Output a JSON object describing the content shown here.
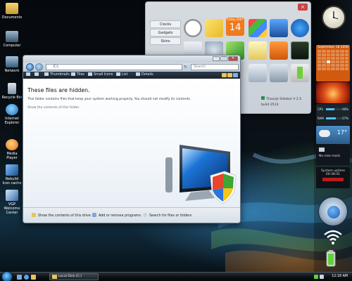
{
  "desktop": {
    "icons": [
      {
        "label": "Documents"
      },
      {
        "label": "Computer"
      },
      {
        "label": "Network"
      },
      {
        "label": "Recycle Bin"
      },
      {
        "label": "Internet Explorer"
      },
      {
        "label": "Media Player"
      },
      {
        "label": "Rebuild Icon cache"
      },
      {
        "label": "VGP Welcome Center"
      }
    ]
  },
  "gallery": {
    "tabs": [
      "Clocks",
      "Gadgets",
      "Skins"
    ],
    "calendar_month": "Friday 2007",
    "calendar_day": "14",
    "footer": "Thoosje Sidebar V 2.5  build 2514"
  },
  "explorer": {
    "address": "C:\\",
    "search_placeholder": "Search",
    "toolbar": {
      "organize": "",
      "thumbnails": "Thumbnails",
      "tiles": "Tiles",
      "small_icons": "Small Icons",
      "list": "List",
      "details": "Details"
    },
    "heading": "These files are hidden.",
    "description": "This folder contains files that keep your system working properly. You should not modify its contents.",
    "show_link": "Show the contents of this folder",
    "tasks": {
      "show_drive": "Show the contents of this drive",
      "add_remove": "Add or remove programs",
      "search": "Search for files or folders"
    }
  },
  "sidebar": {
    "calendar_header": "September 18 2008",
    "cpu_label": "CPU",
    "ram_label": "RAM",
    "cpu_percent": 48,
    "ram_percent": 57,
    "cpu_text": "48%",
    "ram_text": "57%",
    "weather_temp": "17°",
    "mail_text": "No new mails",
    "uptime_label": "System uptime",
    "uptime_value": "00:38:41"
  },
  "taskbar": {
    "task_label": "Local Disk (C:)",
    "time": "12:18 AM"
  },
  "colors": {
    "calendar_orange": "#d25a0e",
    "toolbar_dark": "#1f2a35",
    "uptime_red": "#b81d1d"
  }
}
